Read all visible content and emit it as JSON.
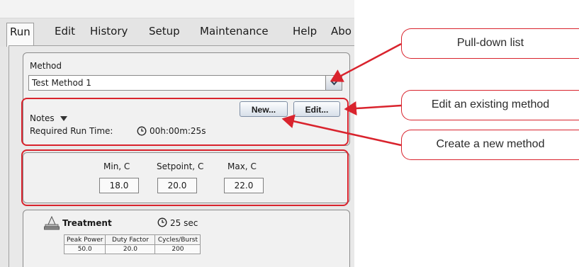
{
  "menu": {
    "items": [
      {
        "label": "Run"
      },
      {
        "label": "Edit"
      },
      {
        "label": "History"
      },
      {
        "label": "Setup"
      },
      {
        "label": "Maintenance"
      },
      {
        "label": "Help"
      },
      {
        "label": "Abo"
      }
    ]
  },
  "method": {
    "label": "Method",
    "selected": "Test Method 1",
    "dropdown_icon": "chevron-down-icon"
  },
  "buttons": {
    "new_label": "New...",
    "edit_label": "Edit..."
  },
  "notes": {
    "label": "Notes",
    "run_time_label": "Required Run Time:",
    "run_time_value": "00h:00m:25s"
  },
  "temperature": {
    "min_label": "Min, C",
    "min_value": "18.0",
    "setpoint_label": "Setpoint, C",
    "setpoint_value": "20.0",
    "max_label": "Max, C",
    "max_value": "22.0"
  },
  "treatment": {
    "label": "Treatment",
    "duration": "25 sec",
    "columns": [
      "Peak Power",
      "Duty Factor",
      "Cycles/Burst"
    ],
    "values": [
      "50.0",
      "20.0",
      "200"
    ]
  },
  "annotations": {
    "pulldown": "Pull-down list",
    "edit_existing": "Edit an existing method",
    "create_new": "Create a new method"
  },
  "colors": {
    "annotation_red": "#d9232d",
    "button_border": "#7e8ea4"
  }
}
